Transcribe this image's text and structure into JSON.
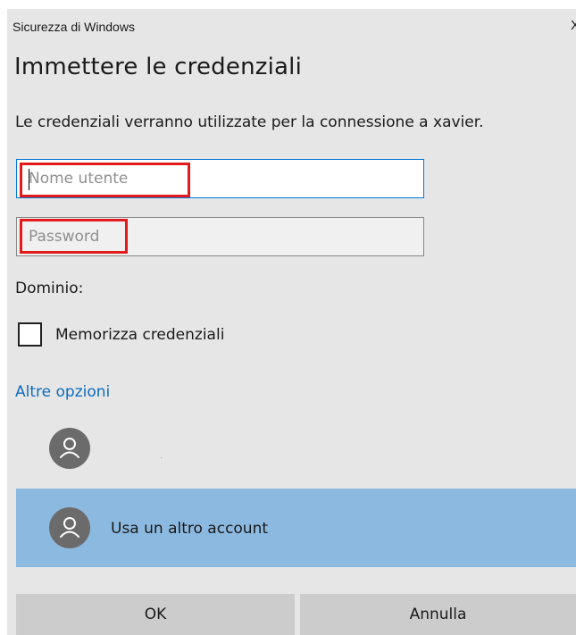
{
  "window": {
    "title": "Sicurezza di Windows",
    "close_glyph": "X"
  },
  "dialog": {
    "heading": "Immettere le credenziali",
    "description": "Le credenziali verranno utilizzate per la connessione a xavier."
  },
  "form": {
    "username": {
      "value": "",
      "placeholder": "Nome utente"
    },
    "password": {
      "value": "",
      "placeholder": "Password"
    },
    "domain_label": "Dominio:",
    "remember": {
      "label": "Memorizza credenziali",
      "checked": false
    }
  },
  "more_options": {
    "label": "Altre opzioni",
    "accounts": [
      {
        "label": "",
        "icon": "user-icon",
        "selected": false
      },
      {
        "label": "Usa un altro account",
        "icon": "user-icon",
        "selected": true
      }
    ]
  },
  "buttons": {
    "ok": "OK",
    "cancel": "Annulla"
  },
  "colors": {
    "background": "#e6e6e6",
    "focus_border": "#0078d7",
    "link": "#0f6cbd",
    "selected_row": "#8cb9e0",
    "highlight": "#e11b1b",
    "button": "#cccccc"
  }
}
